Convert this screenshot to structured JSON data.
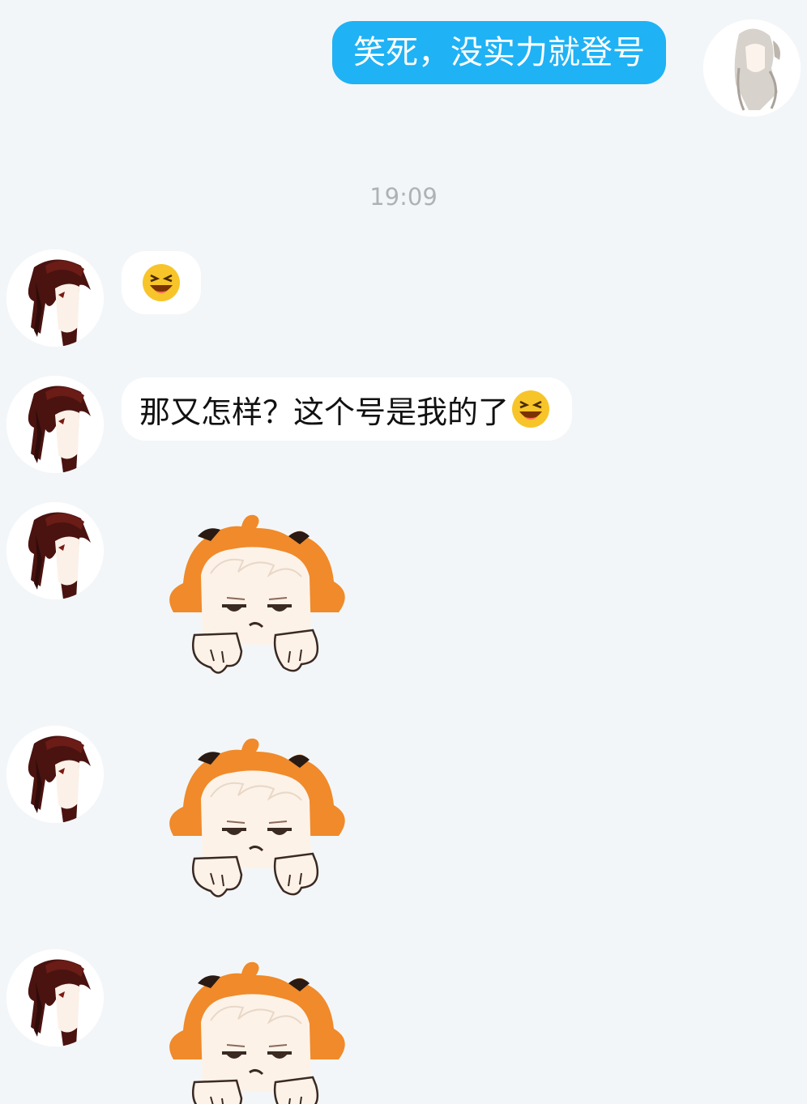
{
  "timestamp": "19:09",
  "messages": [
    {
      "sender": "me",
      "type": "text",
      "text": "笑死，没实力就登号",
      "avatar_icon": "white-hair-anime-avatar"
    },
    {
      "sender": "other",
      "type": "emoji",
      "emoji_icon": "laughing-face-emoji",
      "avatar_icon": "dark-red-hair-anime-avatar"
    },
    {
      "sender": "other",
      "type": "text",
      "text": "那又怎样？这个号是我的了",
      "trailing_emoji": "laughing-face-emoji",
      "avatar_icon": "dark-red-hair-anime-avatar"
    },
    {
      "sender": "other",
      "type": "sticker",
      "sticker_icon": "orange-hair-chibi-sticker",
      "avatar_icon": "dark-red-hair-anime-avatar"
    },
    {
      "sender": "other",
      "type": "sticker",
      "sticker_icon": "orange-hair-chibi-sticker",
      "avatar_icon": "dark-red-hair-anime-avatar"
    },
    {
      "sender": "other",
      "type": "sticker",
      "sticker_icon": "orange-hair-chibi-sticker",
      "avatar_icon": "dark-red-hair-anime-avatar"
    }
  ],
  "colors": {
    "background": "#f3f6f8",
    "outgoing_bubble": "#1fb2f5",
    "incoming_bubble": "#ffffff",
    "timestamp_text": "#aeb2b6",
    "sticker_hair": "#f08a2a"
  }
}
